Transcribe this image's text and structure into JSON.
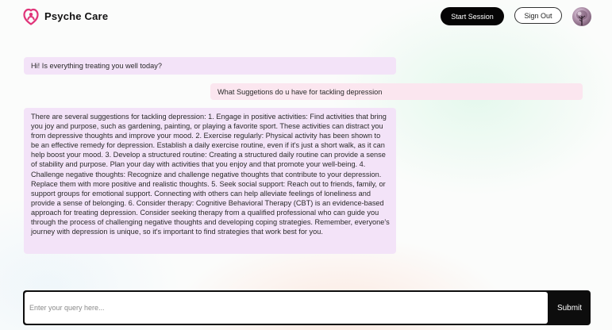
{
  "header": {
    "logo_icon": "heart-user-icon",
    "brand": "Psyche Care",
    "start_session_label": "Start Session",
    "sign_out_label": "Sign Out",
    "avatar_icon": "user-avatar-icon",
    "accent_color": "#e0357a"
  },
  "chat": {
    "messages": [
      {
        "role": "assistant",
        "text": "Hi! Is everything treating you well today?"
      },
      {
        "role": "user",
        "text": "What Suggetions do u have for tackling depression"
      },
      {
        "role": "assistant",
        "text": "There are several suggestions for tackling depression: 1. Engage in positive activities: Find activities that bring you joy and purpose, such as gardening, painting, or playing a favorite sport. These activities can distract you from depressive thoughts and improve your mood. 2. Exercise regularly: Physical activity has been shown to be an effective remedy for depression. Establish a daily exercise routine, even if it's just a short walk, as it can help boost your mood. 3. Develop a structured routine: Creating a structured daily routine can provide a sense of stability and purpose. Plan your day with activities that you enjoy and that promote your well-being. 4. Challenge negative thoughts: Recognize and challenge negative thoughts that contribute to your depression. Replace them with more positive and realistic thoughts. 5. Seek social support: Reach out to friends, family, or support groups for emotional support. Connecting with others can help alleviate feelings of loneliness and provide a sense of belonging. 6. Consider therapy: Cognitive Behavioral Therapy (CBT) is an evidence-based approach for treating depression. Consider seeking therapy from a qualified professional who can guide you through the process of challenging negative thoughts and developing coping strategies. Remember, everyone's journey with depression is unique, so it's important to find strategies that work best for you."
      }
    ]
  },
  "composer": {
    "placeholder": "Enter your query here...",
    "value": "",
    "submit_label": "Submit"
  }
}
